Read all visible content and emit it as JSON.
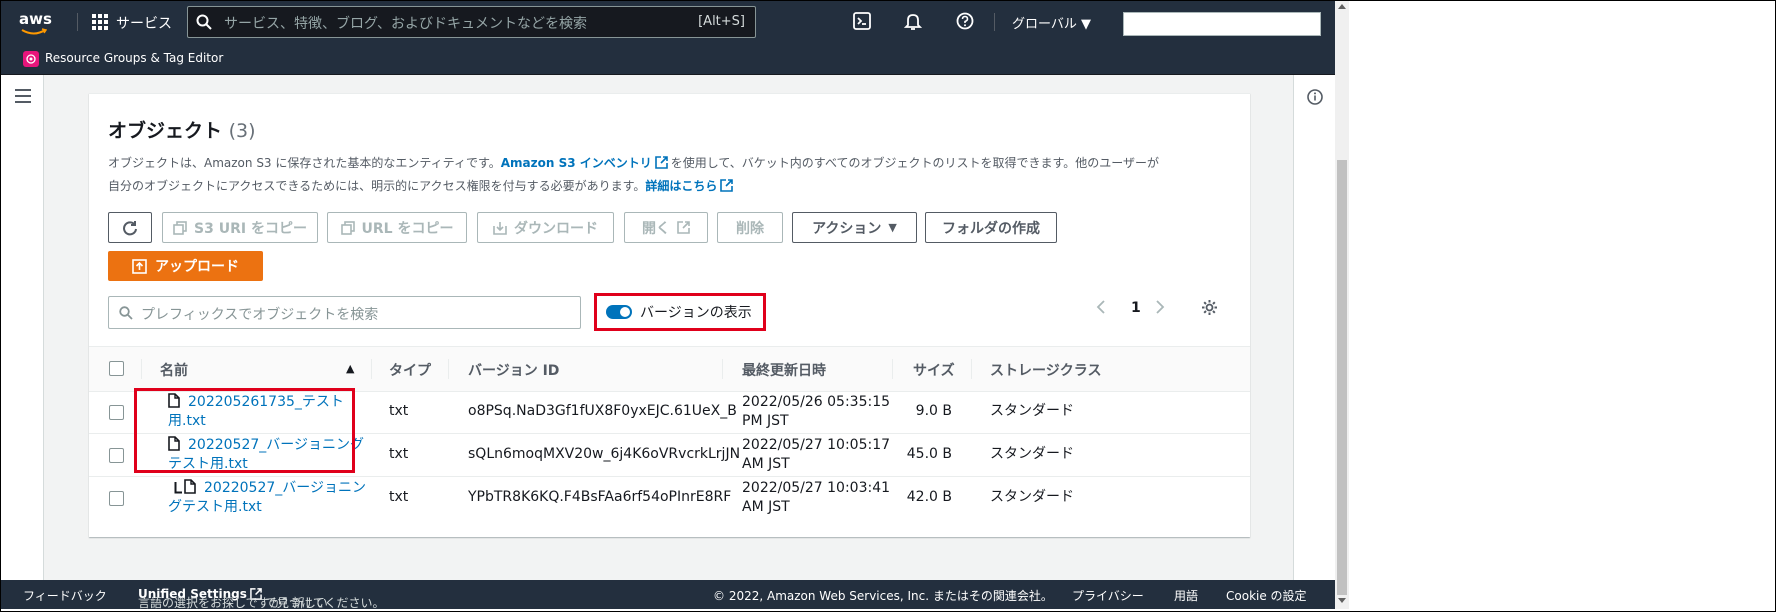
{
  "topbar": {
    "logo": "aws",
    "services_label": "サービス",
    "search_placeholder": "サービス、特徴、ブログ、およびドキュメントなどを検索",
    "search_shortcut": "[Alt+S]",
    "region_label": "グローバル"
  },
  "subbar": {
    "service_label": "Resource Groups & Tag Editor"
  },
  "objects": {
    "title": "オブジェクト",
    "count": "(3)",
    "desc_1": "オブジェクトは、Amazon S3 に保存された基本的なエンティティです。",
    "desc_link_1": "Amazon S3 インベントリ",
    "desc_2": "を使用して、バケット内のすべてのオブジェクトのリストを取得できます。他のユーザーが",
    "desc_3": "自分のオブジェクトにアクセスできるためには、明示的にアクセス権限を付与する必要があります。",
    "desc_link_2": "詳細はこちら"
  },
  "toolbar": {
    "copy_s3_uri": "S3 URI をコピー",
    "copy_url": "URL をコピー",
    "download": "ダウンロード",
    "open": "開く",
    "delete": "削除",
    "actions": "アクション",
    "create_folder": "フォルダの作成",
    "upload": "アップロード"
  },
  "filter": {
    "placeholder": "プレフィックスでオブジェクトを検索",
    "show_versions": "バージョンの表示",
    "show_versions_on": true
  },
  "pagination": {
    "page": "1"
  },
  "table": {
    "headers": {
      "name": "名前",
      "type": "タイプ",
      "version_id": "バージョン ID",
      "last_modified": "最終更新日時",
      "size": "サイズ",
      "storage_class": "ストレージクラス"
    },
    "rows": [
      {
        "name_1": "202205261735_テスト",
        "name_2": "用.txt",
        "type": "txt",
        "version_id": "o8PSq.NaD3Gf1fUX8F0yxEJC.61UeX_B",
        "modified_1": "2022/05/26 05:35:15",
        "modified_2": "PM JST",
        "size": "9.0 B",
        "storage_class": "スタンダード"
      },
      {
        "name_1": "20220527_バージョニング",
        "name_2": "テスト用.txt",
        "type": "txt",
        "version_id": "sQLn6moqMXV20w_6j4K6oVRvcrkLrjJN",
        "modified_1": "2022/05/27 10:05:17",
        "modified_2": "AM JST",
        "size": "45.0 B",
        "storage_class": "スタンダード"
      },
      {
        "name_1": "20220527_バージョニン",
        "name_2": "グテスト用.txt",
        "type": "txt",
        "version_id": "YPbTR8K6KQ.F4BsFAa6rf54oPInrE8RF",
        "modified_1": "2022/05/27 10:03:41",
        "modified_2": "AM JST",
        "size": "42.0 B",
        "storage_class": "スタンダード"
      }
    ]
  },
  "footer": {
    "feedback": "フィードバック",
    "lang_1": "言語の選択をお探しですか? 新しい",
    "lang_link": "Unified Settings",
    "lang_2": "で見つけてください。",
    "copyright": "© 2022, Amazon Web Services, Inc. またはその関連会社。",
    "privacy": "プライバシー",
    "terms": "用語",
    "cookie": "Cookie の設定"
  },
  "colors": {
    "header_bg": "#232f3e",
    "accent_orange": "#ec7211",
    "link_blue": "#0073bb",
    "highlight_red": "#e0001b"
  }
}
